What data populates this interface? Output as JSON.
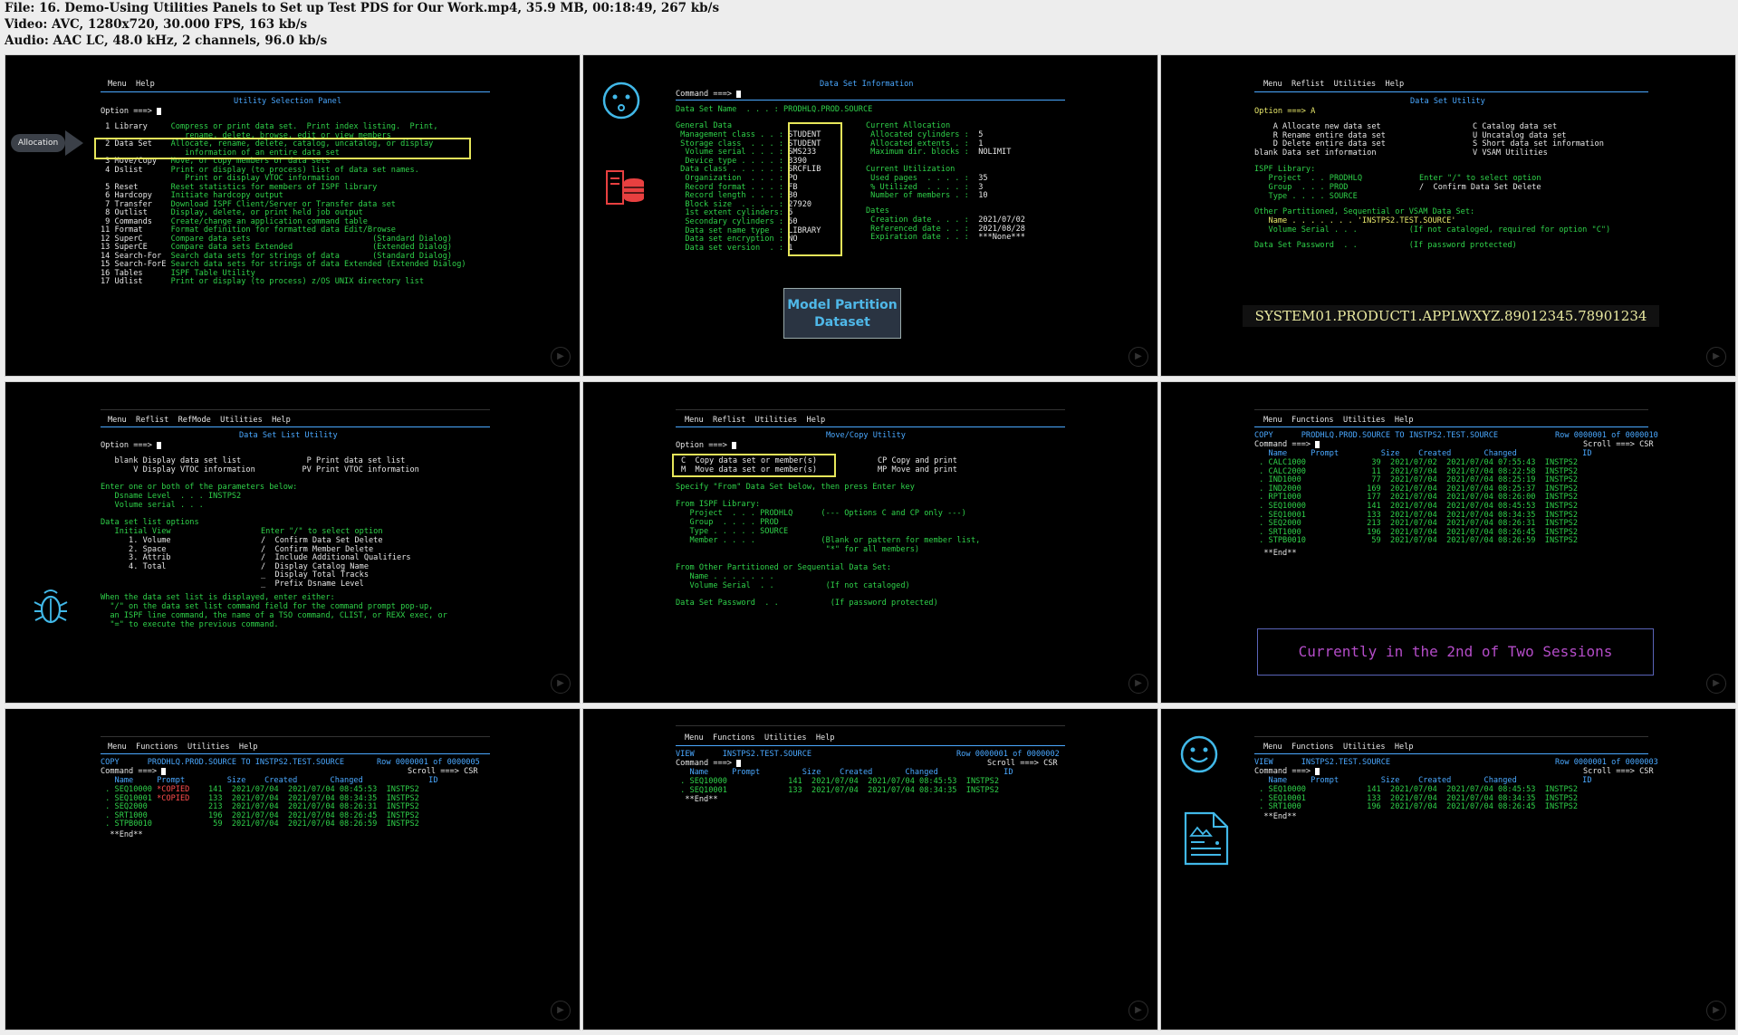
{
  "header": {
    "file_line": "File: 16. Demo-Using Utilities Panels to Set up Test PDS for Our Work.mp4, 35.9 MB, 00:18:49, 267 kb/s",
    "video_line": "Video: AVC, 1280x720, 30.000 FPS, 163 kb/s",
    "audio_line": "Audio: AAC LC, 48.0 kHz, 2 channels, 96.0 kb/s"
  },
  "colors": {
    "green": "#2fd24a",
    "blue": "#4aa8ff",
    "white": "#e6e6e6",
    "yellow": "#e8e86a",
    "red": "#ff4d4d"
  },
  "thumb1": {
    "menubar": "Menu  Help",
    "title": "Utility Selection Panel",
    "option": "Option ===>",
    "callout": "Allocation",
    "items": [
      {
        "n": " 1",
        "name": "Library    ",
        "desc": "Compress or print data set.  Print index listing.  Print,"
      },
      {
        "n": "   ",
        "name": "           ",
        "desc": "  rename, delete, browse, edit or view members"
      },
      {
        "n": " 2",
        "name": "Data Set   ",
        "desc": "Allocate, rename, delete, catalog, uncatalog, or display"
      },
      {
        "n": "   ",
        "name": "           ",
        "desc": "  information of an entire data set"
      },
      {
        "n": " 3",
        "name": "Move/Copy  ",
        "desc": "Move, or copy members or data sets"
      },
      {
        "n": " 4",
        "name": "Dslist     ",
        "desc": "Print or display (to process) list of data set names."
      },
      {
        "n": "   ",
        "name": "           ",
        "desc": "  Print or display VTOC information"
      },
      {
        "n": " 5",
        "name": "Reset      ",
        "desc": "Reset statistics for members of ISPF library"
      },
      {
        "n": " 6",
        "name": "Hardcopy   ",
        "desc": "Initiate hardcopy output"
      },
      {
        "n": " 7",
        "name": "Transfer   ",
        "desc": "Download ISPF Client/Server or Transfer data set"
      },
      {
        "n": " 8",
        "name": "Outlist    ",
        "desc": "Display, delete, or print held job output"
      },
      {
        "n": " 9",
        "name": "Commands   ",
        "desc": "Create/change an application command table"
      },
      {
        "n": "11",
        "name": "Format     ",
        "desc": "Format definition for formatted data Edit/Browse"
      },
      {
        "n": "12",
        "name": "SuperC     ",
        "desc": "Compare data sets                          (Standard Dialog)"
      },
      {
        "n": "13",
        "name": "SuperCE    ",
        "desc": "Compare data sets Extended                 (Extended Dialog)"
      },
      {
        "n": "14",
        "name": "Search-For ",
        "desc": "Search data sets for strings of data       (Standard Dialog)"
      },
      {
        "n": "15",
        "name": "Search-ForE",
        "desc": "Search data sets for strings of data Extended (Extended Dialog)"
      },
      {
        "n": "16",
        "name": "Tables     ",
        "desc": "ISPF Table Utility"
      },
      {
        "n": "17",
        "name": "Udlist     ",
        "desc": "Print or display (to process) z/OS UNIX directory list"
      }
    ]
  },
  "thumb2": {
    "title": "Data Set Information",
    "command": "Command ===>",
    "dsname": "Data Set Name  . . . : PRODHLQ.PROD.SOURCE",
    "general_hdr": "General Data",
    "general": [
      {
        "k": " Management class . . :",
        "v": "STUDENT"
      },
      {
        "k": " Storage class  . . . :",
        "v": "STUDENT"
      },
      {
        "k": "  Volume serial . . . :",
        "v": "SMS233"
      },
      {
        "k": "  Device type . . . . :",
        "v": "3390"
      },
      {
        "k": " Data class . . . . . :",
        "v": "SRCFLIB"
      },
      {
        "k": "  Organization  . . . :",
        "v": "PO"
      },
      {
        "k": "  Record format . . . :",
        "v": "FB"
      },
      {
        "k": "  Record length . . . :",
        "v": "80"
      },
      {
        "k": "  Block size  . . . . :",
        "v": "27920"
      },
      {
        "k": "  1st extent cylinders:",
        "v": "5"
      },
      {
        "k": "  Secondary cylinders :",
        "v": "50"
      },
      {
        "k": "  Data set name type  :",
        "v": "LIBRARY"
      },
      {
        "k": "  Data set encryption :",
        "v": "NO"
      },
      {
        "k": "  Data set version  . :",
        "v": "1"
      }
    ],
    "alloc_hdr": "Current Allocation",
    "alloc": [
      {
        "k": " Allocated cylinders : ",
        "v": "5"
      },
      {
        "k": " Allocated extents . : ",
        "v": "1"
      },
      {
        "k": " Maximum dir. blocks : ",
        "v": "NOLIMIT"
      }
    ],
    "util_hdr": "Current Utilization",
    "util": [
      {
        "k": " Used pages  . . . . : ",
        "v": "35"
      },
      {
        "k": " % Utilized  . . . . : ",
        "v": "3"
      },
      {
        "k": " Number of members . : ",
        "v": "10"
      }
    ],
    "dates_hdr": "Dates",
    "dates": [
      {
        "k": " Creation date . . . : ",
        "v": "2021/07/02"
      },
      {
        "k": " Referenced date . . : ",
        "v": "2021/08/28"
      },
      {
        "k": " Expiration date . . : ",
        "v": "***None***"
      }
    ],
    "callout": "Model Partition\nDataset"
  },
  "thumb3": {
    "menubar": "Menu  Reflist  Utilities  Help",
    "title": "Data Set Utility",
    "option": "Option ===> A",
    "left_opts": [
      "    A Allocate new data set",
      "    R Rename entire data set",
      "    D Delete entire data set",
      "blank Data set information"
    ],
    "right_opts": [
      "C Catalog data set",
      "U Uncatalog data set",
      "S Short data set information",
      "V VSAM Utilities"
    ],
    "ispf_hdr": "ISPF Library:",
    "project": "   Project  . . PRODHLQ",
    "group": "   Group  . . . PROD",
    "type": "   Type . . . . SOURCE",
    "enter_opt": "Enter \"/\" to select option",
    "confirm": "/  Confirm Data Set Delete",
    "other_hdr": "Other Partitioned, Sequential or VSAM Data Set:",
    "name": "   Name . . . . . . . 'INSTPS2.TEST.SOURCE'",
    "volser": "   Volume Serial . . .           (If not cataloged, required for option \"C\")",
    "password": "Data Set Password  . .           (If password protected)",
    "sysname": "SYSTEM01.PRODUCT1.APPLWXYZ.89012345.78901234"
  },
  "thumb4": {
    "menubar": "Menu  Reflist  RefMode  Utilities  Help",
    "title": "Data Set List Utility",
    "option": "Option ===>",
    "opt1": "   blank Display data set list              P Print data set list",
    "opt2": "       V Display VTOC information          PV Print VTOC information",
    "enter_params": "Enter one or both of the parameters below:",
    "dsname": "   Dsname Level  . . . INSTPS2",
    "volser": "   Volume serial . . .",
    "list_hdr": "Data set list options",
    "init_view": "   Initial View",
    "enter_sel": "Enter \"/\" to select option",
    "views": [
      "      1. Volume",
      "      2. Space",
      "      3. Attrib",
      "      4. Total"
    ],
    "selopts": [
      "/  Confirm Data Set Delete",
      "/  Confirm Member Delete",
      "/  Include Additional Qualifiers",
      "/  Display Catalog Name",
      "_  Display Total Tracks",
      "_  Prefix Dsname Level"
    ],
    "when1": "When the data set list is displayed, enter either:",
    "when2": "  \"/\" on the data set list command field for the command prompt pop-up,",
    "when3": "  an ISPF line command, the name of a TSO command, CLIST, or REXX exec, or",
    "when4": "  \"=\" to execute the previous command."
  },
  "thumb5": {
    "menubar": "Menu  Reflist  Utilities  Help",
    "title": "Move/Copy Utility",
    "option": "Option ===>",
    "c_opt": "C  Copy data set or member(s)",
    "cp_opt": "CP Copy and print",
    "m_opt": "M  Move data set or member(s)",
    "mp_opt": "MP Move and print",
    "specify": "Specify \"From\" Data Set below, then press Enter key",
    "from_hdr": "From ISPF Library:",
    "project": "   Project  . . . PRODHLQ      (--- Options C and CP only ---)",
    "group": "   Group  . . . . PROD",
    "type": "   Type . . . . . SOURCE",
    "member": "   Member . . . .              (Blank or pattern for member list,",
    "member2": "                                \"*\" for all members)",
    "other_hdr": "From Other Partitioned or Sequential Data Set:",
    "name": "   Name . . . . . . .",
    "volser": "   Volume Serial  . .           (If not cataloged)",
    "password": "Data Set Password  . .           (If password protected)"
  },
  "thumb6": {
    "menubar": "Menu  Functions  Utilities  Help",
    "status_l": "COPY      PRODHLQ.PROD.SOURCE TO INSTPS2.TEST.SOURCE",
    "status_r": "Row 0000001 of 0000010",
    "command": "Command ===>",
    "scroll": "Scroll ===> CSR",
    "cols": "   Name     Prompt         Size    Created       Changed              ID",
    "rows": [
      " . CALC1000              39  2021/07/02  2021/07/04 07:55:43  INSTPS2",
      " . CALC2000              11  2021/07/04  2021/07/04 08:22:58  INSTPS2",
      " . IND1000               77  2021/07/04  2021/07/04 08:25:19  INSTPS2",
      " . IND2000              169  2021/07/04  2021/07/04 08:25:37  INSTPS2",
      " . RPT1000              177  2021/07/04  2021/07/04 08:26:00  INSTPS2",
      " . SEQ10000             141  2021/07/04  2021/07/04 08:45:53  INSTPS2",
      " . SEQ10001             133  2021/07/04  2021/07/04 08:34:35  INSTPS2",
      " . SEQ2000              213  2021/07/04  2021/07/04 08:26:31  INSTPS2",
      " . SRT1000              196  2021/07/04  2021/07/04 08:26:45  INSTPS2",
      " . STPB0010              59  2021/07/04  2021/07/04 08:26:59  INSTPS2"
    ],
    "end": "  **End**",
    "banner": "Currently in the 2nd of Two Sessions"
  },
  "thumb7": {
    "menubar": "Menu  Functions  Utilities  Help",
    "status_l": "COPY      PRODHLQ.PROD.SOURCE TO INSTPS2.TEST.SOURCE",
    "status_r": "Row 0000001 of 0000005",
    "command": "Command ===>",
    "scroll": "Scroll ===> CSR",
    "cols": "   Name     Prompt         Size    Created       Changed              ID",
    "rows": [
      {
        "name": " . SEQ10000 ",
        "tag": "*COPIED",
        "rest": "    141  2021/07/04  2021/07/04 08:45:53  INSTPS2"
      },
      {
        "name": " . SEQ10001 ",
        "tag": "*COPIED",
        "rest": "    133  2021/07/04  2021/07/04 08:34:35  INSTPS2"
      },
      {
        "name": " . SEQ2000  ",
        "tag": "       ",
        "rest": "    213  2021/07/04  2021/07/04 08:26:31  INSTPS2"
      },
      {
        "name": " . SRT1000  ",
        "tag": "       ",
        "rest": "    196  2021/07/04  2021/07/04 08:26:45  INSTPS2"
      },
      {
        "name": " . STPB0010 ",
        "tag": "       ",
        "rest": "     59  2021/07/04  2021/07/04 08:26:59  INSTPS2"
      }
    ],
    "end": "  **End**"
  },
  "thumb8": {
    "menubar": "Menu  Functions  Utilities  Help",
    "status_l": "VIEW      INSTPS2.TEST.SOURCE",
    "status_r": "Row 0000001 of 0000002",
    "command": "Command ===>",
    "scroll": "Scroll ===> CSR",
    "cols": "   Name     Prompt         Size    Created       Changed              ID",
    "rows": [
      " . SEQ10000             141  2021/07/04  2021/07/04 08:45:53  INSTPS2",
      " . SEQ10001             133  2021/07/04  2021/07/04 08:34:35  INSTPS2"
    ],
    "end": "  **End**"
  },
  "thumb9": {
    "menubar": "Menu  Functions  Utilities  Help",
    "status_l": "VIEW      INSTPS2.TEST.SOURCE",
    "status_r": "Row 0000001 of 0000003",
    "command": "Command ===>",
    "scroll": "Scroll ===> CSR",
    "cols": "   Name     Prompt         Size    Created       Changed              ID",
    "rows": [
      " . SEQ10000             141  2021/07/04  2021/07/04 08:45:53  INSTPS2",
      " . SEQ10001             133  2021/07/04  2021/07/04 08:34:35  INSTPS2",
      " . SRT1000              196  2021/07/04  2021/07/04 08:26:45  INSTPS2"
    ],
    "end": "  **End**"
  },
  "icons": {
    "play": "play-icon",
    "face_sad": "sad-face-icon",
    "face_happy": "smile-face-icon",
    "database": "database-icon",
    "bug": "bug-icon",
    "document": "document-icon"
  }
}
